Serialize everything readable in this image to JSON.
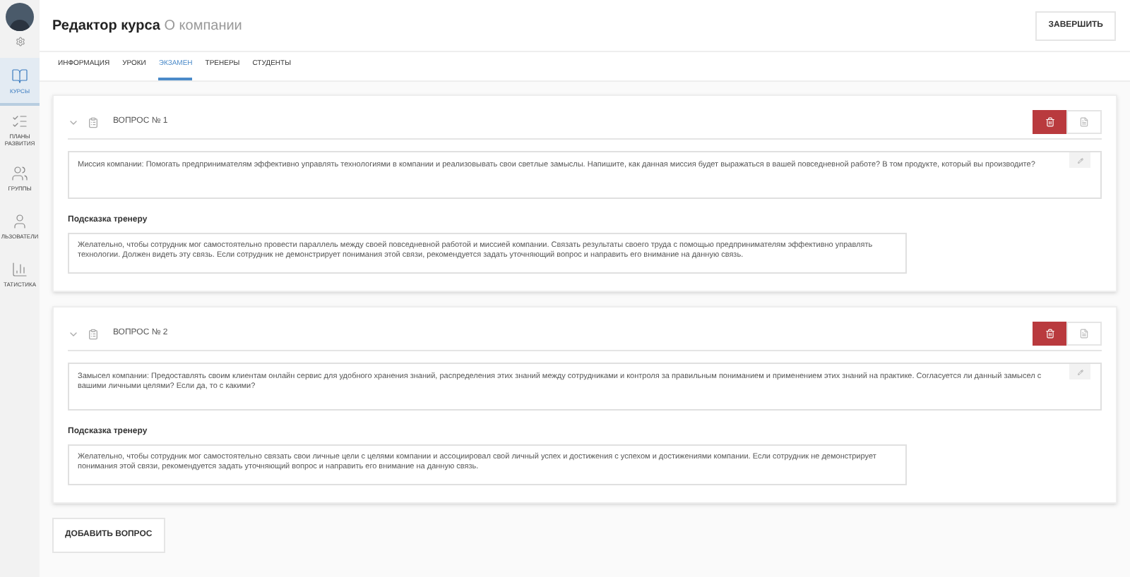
{
  "sidebar": {
    "items": [
      {
        "label": "КУРСЫ",
        "selected": true
      },
      {
        "label": "ПЛАНЫ РАЗВИТИЯ",
        "selected": false
      },
      {
        "label": "ГРУППЫ",
        "selected": false
      },
      {
        "label": "ЛЬЗОВАТЕЛИ",
        "selected": false
      },
      {
        "label": "ТАТИСТИКА",
        "selected": false
      }
    ]
  },
  "header": {
    "title": "Редактор курса",
    "subtitle": "О компании",
    "finish_button": "ЗАВЕРШИТЬ"
  },
  "tabs": [
    {
      "label": "ИНФОРМАЦИЯ",
      "selected": false
    },
    {
      "label": "УРОКИ",
      "selected": false
    },
    {
      "label": "ЭКЗАМЕН",
      "selected": true
    },
    {
      "label": "ТРЕНЕРЫ",
      "selected": false
    },
    {
      "label": "СТУДЕНТЫ",
      "selected": false
    }
  ],
  "questions": [
    {
      "title": "ВОПРОС № 1",
      "text": "Миссия компании: Помогать предпринимателям эффективно управлять технологиями в компании и реализовывать свои светлые замыслы. Напишите, как данная миссия будет выражаться в вашей повседневной работе? В том продукте, который вы производите?",
      "hint_label": "Подсказка тренеру",
      "hint": "Желательно, чтобы сотрудник мог самостоятельно провести параллель между своей повседневной работой и миссией компании. Связать результаты своего труда с помощью предпринимателям эффективно управлять технологии. Должен видеть эту связь. Если сотрудник не демонстрирует понимания этой связи, рекомендуется задать уточняющий вопрос и направить его внимание на данную связь."
    },
    {
      "title": "ВОПРОС № 2",
      "text": "Замысел компании: Предоставлять своим клиентам онлайн сервис для удобного хранения знаний, распределения этих знаний между сотрудниками и контроля за правильным пониманием и применением этих знаний на практике. Согласуется ли данный замысел с вашими личными целями? Если да, то с какими?",
      "hint_label": "Подсказка тренеру",
      "hint": "Желательно, чтобы сотрудник мог самостоятельно связать свои личные цели с целями компании и ассоциировал свой личный успех и достижения с успехом и достижениями компании. Если сотрудник не демонстрирует понимания этой связи, рекомендуется задать уточняющий вопрос и направить его внимание на данную связь."
    }
  ],
  "add_button": "ДОБАВИТЬ ВОПРОС"
}
